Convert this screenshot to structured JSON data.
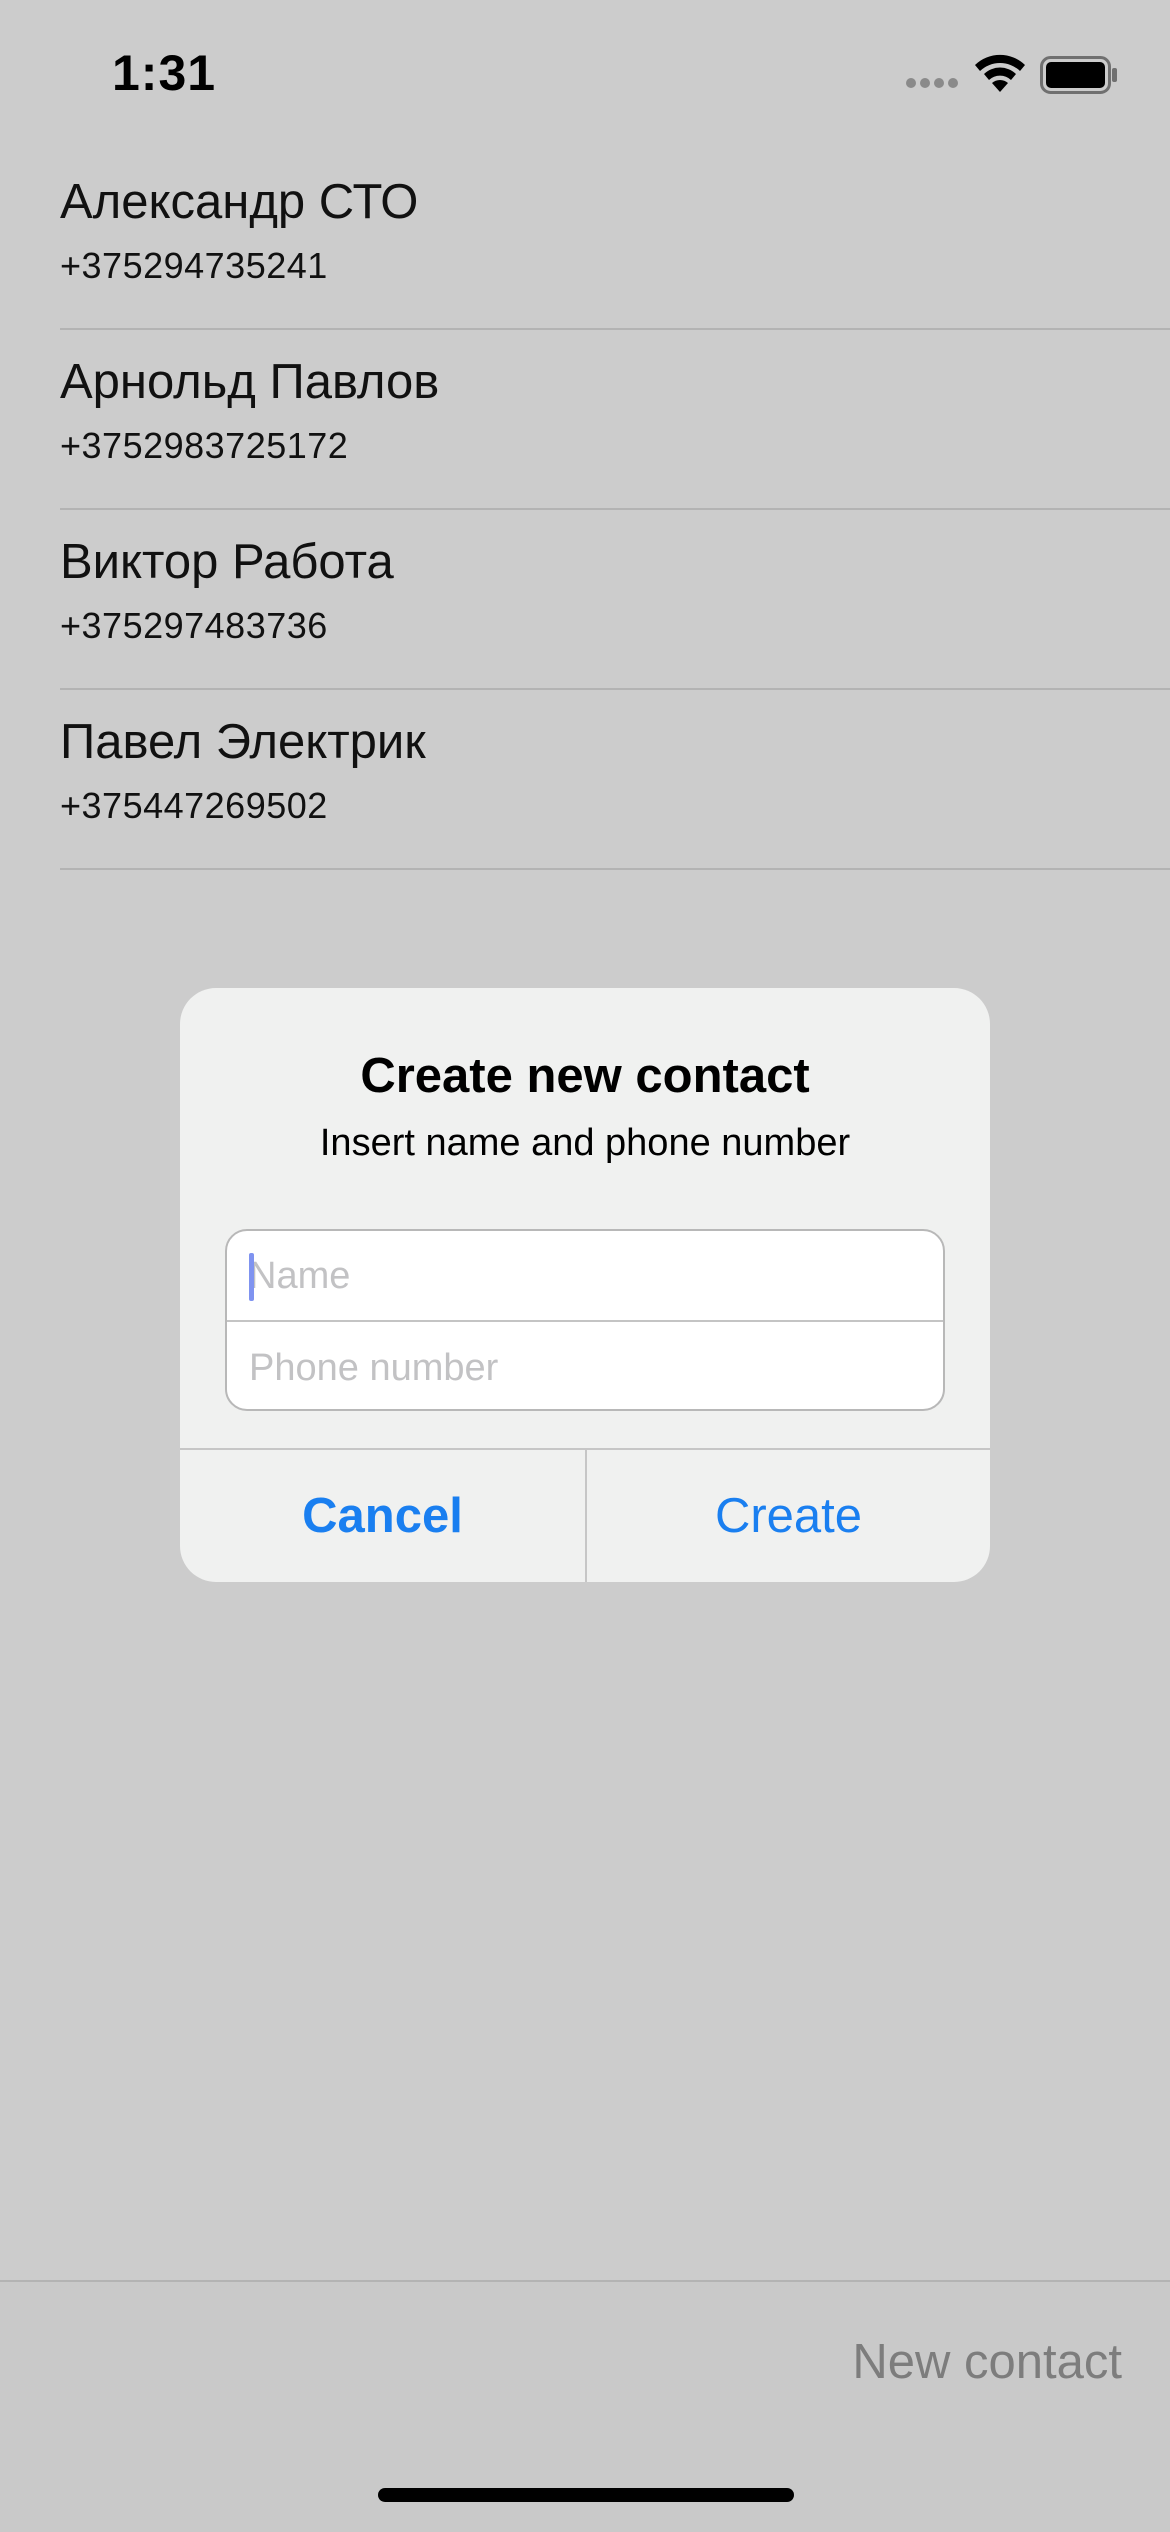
{
  "status_bar": {
    "time": "1:31",
    "icons": [
      "cellular-signal-icon",
      "wifi-icon",
      "battery-icon"
    ]
  },
  "contacts": [
    {
      "name": "Александр СТО",
      "phone": "+375294735241"
    },
    {
      "name": "Арнольд Павлов",
      "phone": "+3752983725172"
    },
    {
      "name": "Виктор Работа",
      "phone": "+375297483736"
    },
    {
      "name": "Павел Электрик",
      "phone": "+375447269502"
    }
  ],
  "alert": {
    "title": "Create new contact",
    "message": "Insert name and phone number",
    "name_field": {
      "placeholder": "Name",
      "value": ""
    },
    "phone_field": {
      "placeholder": "Phone number",
      "value": ""
    },
    "cancel_label": "Cancel",
    "create_label": "Create"
  },
  "toolbar": {
    "new_contact_label": "New contact"
  },
  "colors": {
    "dimmed_background": "#cccccc",
    "alert_background": "#f0f1f0",
    "accent": "#1a7ff0",
    "disabled_text": "#7d7d7d",
    "separator": "#b3b3b3"
  }
}
